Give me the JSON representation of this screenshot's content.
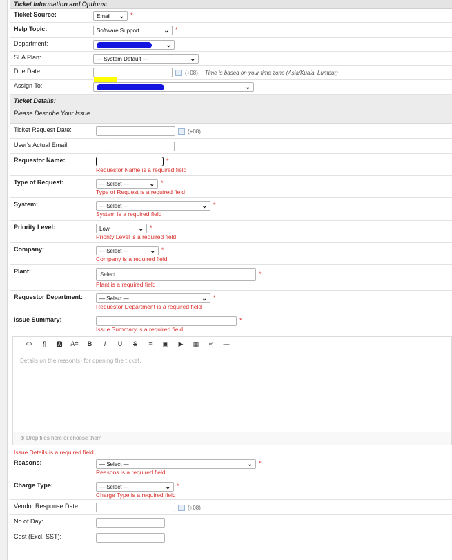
{
  "section_ticket_info": "Ticket Information and Options:",
  "ticket_source": {
    "label": "Ticket Source:",
    "value": "Email"
  },
  "help_topic": {
    "label": "Help Topic:",
    "value": "Software Support"
  },
  "department": {
    "label": "Department:"
  },
  "sla_plan": {
    "label": "SLA Plan:",
    "value": "— System Default —"
  },
  "due_date": {
    "label": "Due Date:",
    "tz": "(+08)",
    "tz_note": "Time is based on your time zone (Asia/Kuala_Lumpur)"
  },
  "assign_to": {
    "label": "Assign To:"
  },
  "section_ticket_details": "Ticket Details:",
  "describe_issue": "Please Describe Your Issue",
  "ticket_request_date": {
    "label": "Ticket Request Date:",
    "tz": "(+08)"
  },
  "users_email": {
    "label": "User's Actual Email:"
  },
  "requestor_name": {
    "label": "Requestor Name:",
    "error": "Requestor Name is a required field"
  },
  "type_of_request": {
    "label": "Type of Request:",
    "value": "— Select —",
    "error": "Type of Request is a required field"
  },
  "system": {
    "label": "System:",
    "value": "— Select —",
    "error": "System is a required field"
  },
  "priority_level": {
    "label": "Priority Level:",
    "value": "Low",
    "error": "Priority Level is a required field"
  },
  "company": {
    "label": "Company:",
    "value": "— Select —",
    "error": "Company is a required field"
  },
  "plant": {
    "label": "Plant:",
    "placeholder": "Select",
    "error": "Plant is a required field"
  },
  "requestor_department": {
    "label": "Requestor Department:",
    "value": "— Select —",
    "error": "Requestor Department is a required field"
  },
  "issue_summary": {
    "label": "Issue Summary:",
    "error": "Issue Summary is a required field"
  },
  "editor": {
    "toolbar": [
      "<>",
      "¶",
      "🅰",
      "A≡",
      "B",
      "I",
      "U",
      "S",
      "≡",
      "▣",
      "▶",
      "▦",
      "∞",
      "—"
    ],
    "placeholder": "Details on the reason(s) for opening the ticket.",
    "drop_text": "⊕ Drop files here or choose them"
  },
  "issue_details_error": "Issue Details is a required field",
  "reasons": {
    "label": "Reasons:",
    "value": "— Select —",
    "error": "Reasons is a required field"
  },
  "charge_type": {
    "label": "Charge Type:",
    "value": "— Select —",
    "error": "Charge Type is a required field"
  },
  "vendor_response_date": {
    "label": "Vendor Response Date:",
    "tz": "(+08)"
  },
  "no_of_day": {
    "label": "No of Day:"
  },
  "cost": {
    "label": "Cost (Excl. SST):"
  },
  "colors": {
    "error": "#d9302c",
    "redaction": "#1515e0",
    "highlight": "#ffff00"
  }
}
